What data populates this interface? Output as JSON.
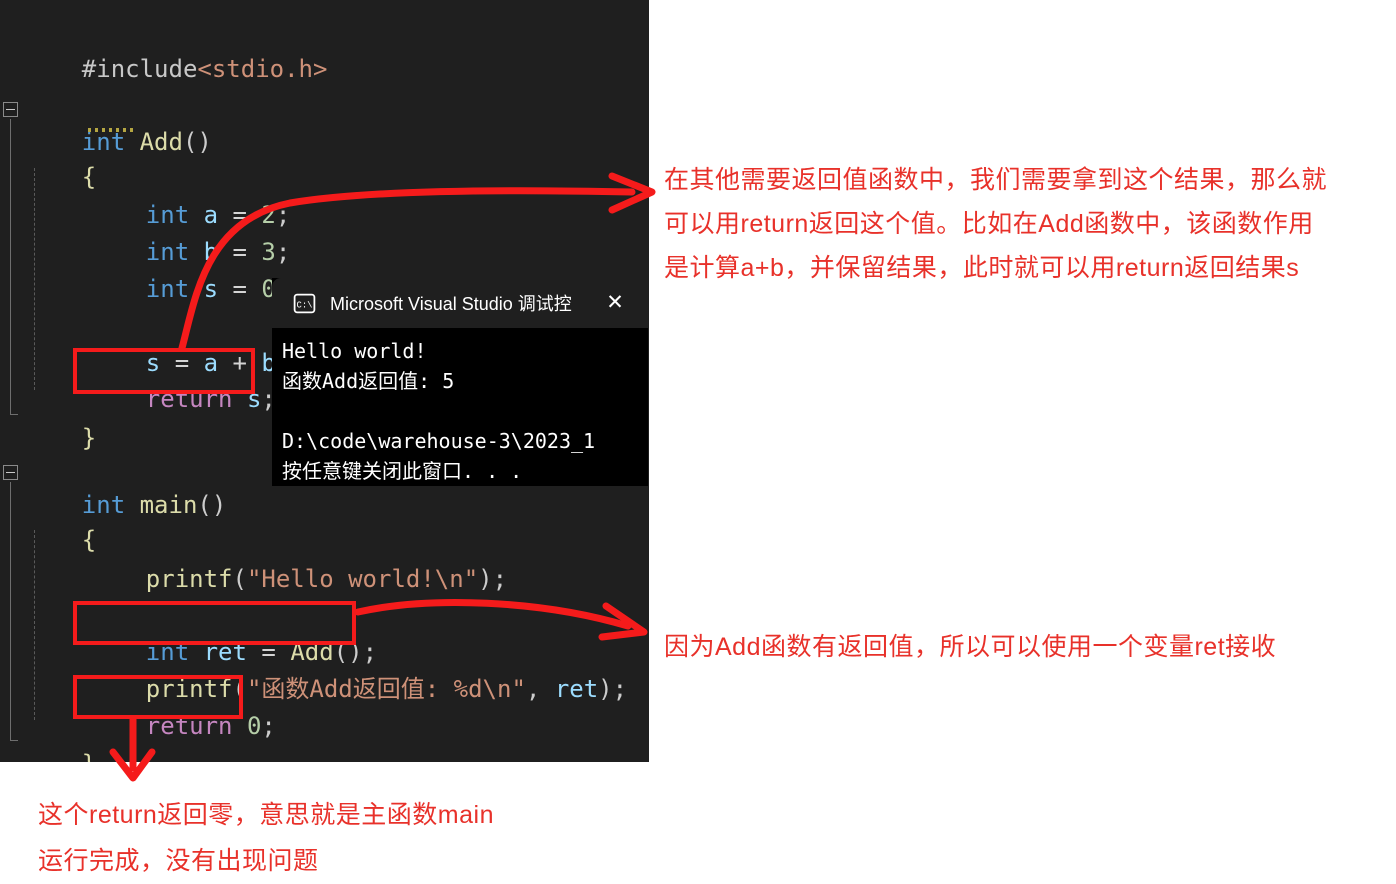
{
  "editor": {
    "background": "#1f1f1f",
    "lines": [
      {
        "id": "include",
        "text": "#include<stdio.h>"
      },
      {
        "id": "add-signature",
        "text": "int Add()"
      },
      {
        "id": "add-open-brace",
        "text": "{"
      },
      {
        "id": "decl-a",
        "text": "int a = 2;"
      },
      {
        "id": "decl-b",
        "text": "int b = 3;"
      },
      {
        "id": "decl-s",
        "text": "int s = 0;"
      },
      {
        "id": "sum",
        "text": "s = a + b;"
      },
      {
        "id": "return-s",
        "text": "return s;"
      },
      {
        "id": "add-close-brace",
        "text": "}"
      },
      {
        "id": "main-signature",
        "text": "int main()"
      },
      {
        "id": "main-open-brace",
        "text": "{"
      },
      {
        "id": "printf-hello",
        "text": "printf(\"Hello world!\\n\");"
      },
      {
        "id": "int-ret",
        "text": "int ret = Add();"
      },
      {
        "id": "printf-ret",
        "text": "printf(\"函数Add返回值: %d\\n\", ret);"
      },
      {
        "id": "return-zero",
        "text": "return 0;"
      },
      {
        "id": "main-close-brace",
        "text": "}"
      }
    ],
    "tokens": {
      "include_directive": "#include",
      "include_header": "<stdio.h>",
      "kw_int": "int",
      "kw_return": "return",
      "fn_add": "Add",
      "fn_main": "main",
      "fn_printf": "printf",
      "var_a": "a",
      "var_b": "b",
      "var_s": "s",
      "var_ret": "ret",
      "num_2": "2",
      "num_3": "3",
      "num_0": "0",
      "str_hello": "\"Hello world!\\n\"",
      "str_ret_fmt": "\"函数Add返回值: %d\\n\"",
      "brace_open": "{",
      "brace_close": "}",
      "paren_empty": "()",
      "semicolon": ";",
      "equals": "=",
      "plus": "+"
    },
    "colors": {
      "keyword": "#569cd6",
      "control": "#c586c0",
      "function": "#dcdcaa",
      "variable": "#9cdcfe",
      "number": "#b5cea8",
      "string": "#ce9178",
      "escape": "#d7ba7d",
      "punctuation": "#cccccc"
    },
    "fold_markers": [
      "add-fold",
      "main-fold"
    ]
  },
  "console": {
    "title": "Microsoft Visual Studio 调试控",
    "close_label": "✕",
    "icon": "console-window-icon",
    "output": "Hello world!\n函数Add返回值: 5\n\nD:\\code\\warehouse-3\\2023_1\n按任意键关闭此窗口. . ."
  },
  "annotations": {
    "highlight_color": "#f51b1b",
    "text_color": "#e8312a",
    "right_top": "在其他需要返回值函数中，我们需要拿到这个结果，那么就\n可以用return返回这个值。比如在Add函数中，该函数作用\n是计算a+b，并保留结果，此时就可以用return返回结果s",
    "right_middle": "因为Add函数有返回值，所以可以使用一个变量ret接收",
    "bottom_left": "这个return返回零，意思就是主函数main\n运行完成，没有出现问题",
    "boxes": [
      {
        "id": "box-return-s",
        "target": "return s;"
      },
      {
        "id": "box-int-ret",
        "target": "int ret = Add();"
      },
      {
        "id": "box-return-zero",
        "target": "return 0;"
      }
    ],
    "arrows": [
      {
        "id": "arrow-return-s-to-right-top",
        "from": "return s;",
        "to": "right_top"
      },
      {
        "id": "arrow-int-ret-to-right-middle",
        "from": "int ret = Add();",
        "to": "right_middle"
      },
      {
        "id": "arrow-return-zero-to-bottom-left",
        "from": "return 0;",
        "to": "bottom_left"
      }
    ]
  }
}
